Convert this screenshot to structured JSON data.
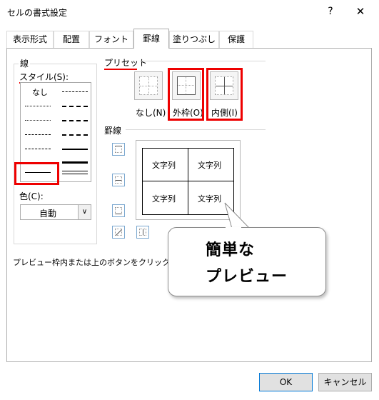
{
  "window": {
    "title": "セルの書式設定",
    "help": "?",
    "close": "✕"
  },
  "tabs": [
    {
      "label": "表示形式"
    },
    {
      "label": "配置"
    },
    {
      "label": "フォント"
    },
    {
      "label": "罫線",
      "active": true
    },
    {
      "label": "塗りつぶし"
    },
    {
      "label": "保護"
    }
  ],
  "line_group": {
    "title": "線",
    "style_label": "スタイル(S):",
    "none_label": "なし",
    "color_label": "色(C):",
    "color_value": "自動",
    "color_arrow": "∨"
  },
  "preset_group": {
    "title": "プリセット",
    "none_label": "なし(N)",
    "outline_label": "外枠(O)",
    "inside_label": "内側(I)"
  },
  "border_group": {
    "title": "罫線",
    "cells": [
      "文字列",
      "文字列",
      "文字列",
      "文字列"
    ]
  },
  "callout": {
    "line1": "簡単な",
    "line2": "プレビュー"
  },
  "description": "プレビュー枠内または上のボタンをクリックすると、",
  "buttons": {
    "ok": "OK",
    "cancel": "キャンセル"
  },
  "colors": {
    "highlight": "#ee0000",
    "ok_border": "#0078d7"
  }
}
